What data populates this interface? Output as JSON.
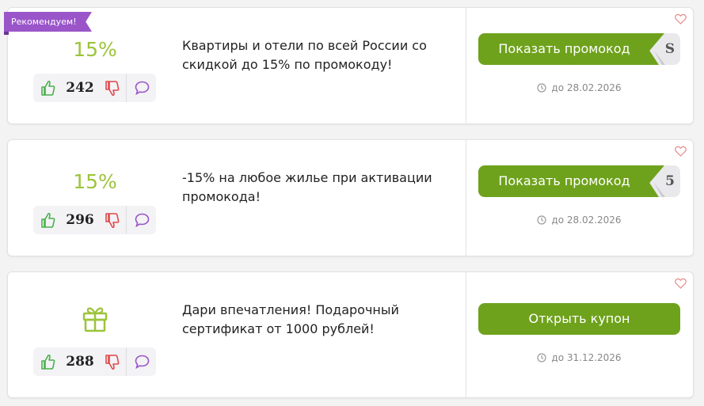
{
  "badge": "Рекомендуем!",
  "offers": [
    {
      "discount": "15%",
      "votes": "242",
      "description_line1": "Квартиры и отели по всей России со",
      "description_line2": "скидкой до 15% по промокоду!",
      "button_label": "Показать промокод",
      "code_hint": "S",
      "expiry": "до 28.02.2026"
    },
    {
      "discount": "15%",
      "votes": "296",
      "description_line1": "-15% на любое жилье при активации",
      "description_line2": "промокода!",
      "button_label": "Показать промокод",
      "code_hint": "5",
      "expiry": "до 28.02.2026"
    },
    {
      "icon": "gift-icon",
      "votes": "288",
      "description_line1": "Дари впечатления! Подарочный",
      "description_line2": "сертификат от 1000 рублей!",
      "button_label": "Открыть купон",
      "expiry": "до 31.12.2026"
    }
  ],
  "colors": {
    "accent_green": "#6fa21c",
    "discount_green": "#9cc43a",
    "badge_purple": "#9a55c9",
    "thumb_up": "#4ab04a",
    "thumb_down": "#e24848",
    "comment": "#9a55c9",
    "heart": "#e58a8a"
  }
}
